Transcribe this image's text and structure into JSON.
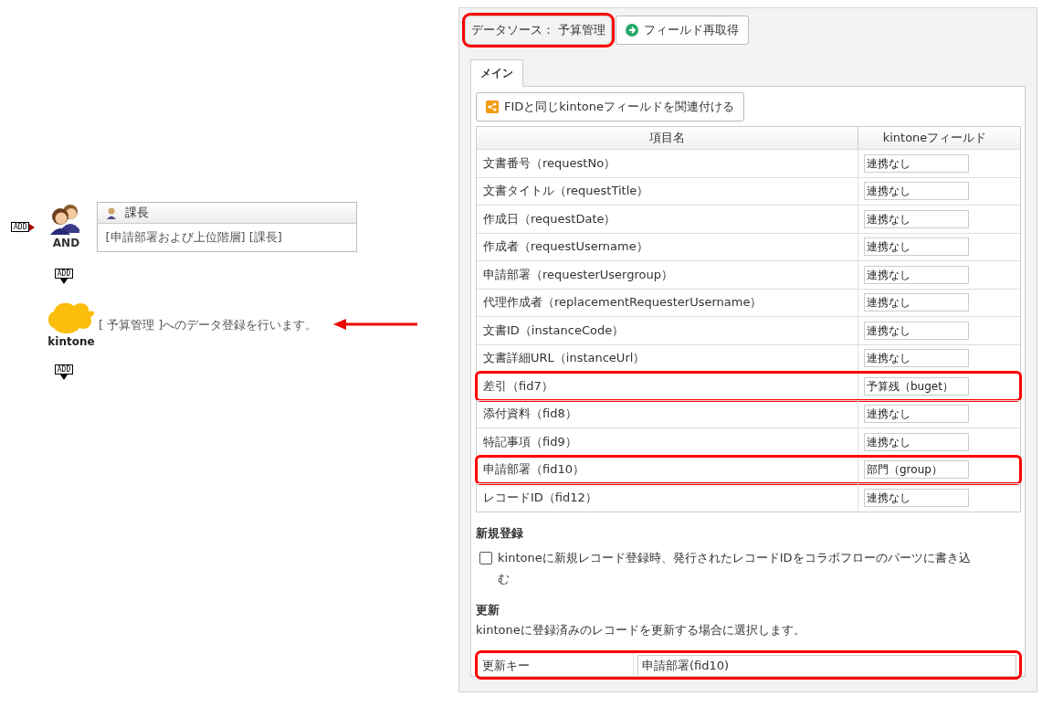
{
  "flow": {
    "start_connector": "ADD",
    "approval_node": {
      "operator": "AND",
      "card_title": "課長",
      "card_body": "[申請部署および上位階層] [課長]"
    },
    "middle_connector": "ADD",
    "kintone_node": {
      "label": "kintone",
      "text": "[ 予算管理 ]へのデータ登録を行います。",
      "pointed": true
    },
    "end_connector": "ADD"
  },
  "panel": {
    "datasource": {
      "label": "データソース： 予算管理",
      "highlighted": true
    },
    "refetch_button": "フィールド再取得",
    "tabs": [
      {
        "label": "メイン",
        "selected": true
      }
    ],
    "link_button": "FIDと同じkintoneフィールドを関連付ける",
    "table": {
      "columns": [
        "項目名",
        "kintoneフィールド"
      ],
      "rows": [
        {
          "item": "文書番号（requestNo）",
          "field": "連携なし",
          "highlighted": false
        },
        {
          "item": "文書タイトル（requestTitle）",
          "field": "連携なし",
          "highlighted": false
        },
        {
          "item": "作成日（requestDate）",
          "field": "連携なし",
          "highlighted": false
        },
        {
          "item": "作成者（requestUsername）",
          "field": "連携なし",
          "highlighted": false
        },
        {
          "item": "申請部署（requesterUsergroup）",
          "field": "連携なし",
          "highlighted": false
        },
        {
          "item": "代理作成者（replacementRequesterUsername）",
          "field": "連携なし",
          "highlighted": false
        },
        {
          "item": "文書ID（instanceCode）",
          "field": "連携なし",
          "highlighted": false
        },
        {
          "item": "文書詳細URL（instanceUrl）",
          "field": "連携なし",
          "highlighted": false
        },
        {
          "item": "差引（fid7）",
          "field": "予算残（buget）",
          "highlighted": true
        },
        {
          "item": "添付資料（fid8）",
          "field": "連携なし",
          "highlighted": false
        },
        {
          "item": "特記事項（fid9）",
          "field": "連携なし",
          "highlighted": false
        },
        {
          "item": "申請部署（fid10）",
          "field": "部門（group）",
          "highlighted": true
        },
        {
          "item": "レコードID（fid12）",
          "field": "連携なし",
          "highlighted": false
        }
      ]
    },
    "new_registration": {
      "heading": "新規登録",
      "checkbox": {
        "label": "kintoneに新規レコード登録時、発行されたレコードIDをコラボフローのパーツに書き込む",
        "checked": false
      }
    },
    "update": {
      "heading": "更新",
      "description": "kintoneに登録済みのレコードを更新する場合に選択します。",
      "key_label": "更新キー",
      "key_value": "申請部署(fid10)",
      "highlighted": true
    }
  }
}
